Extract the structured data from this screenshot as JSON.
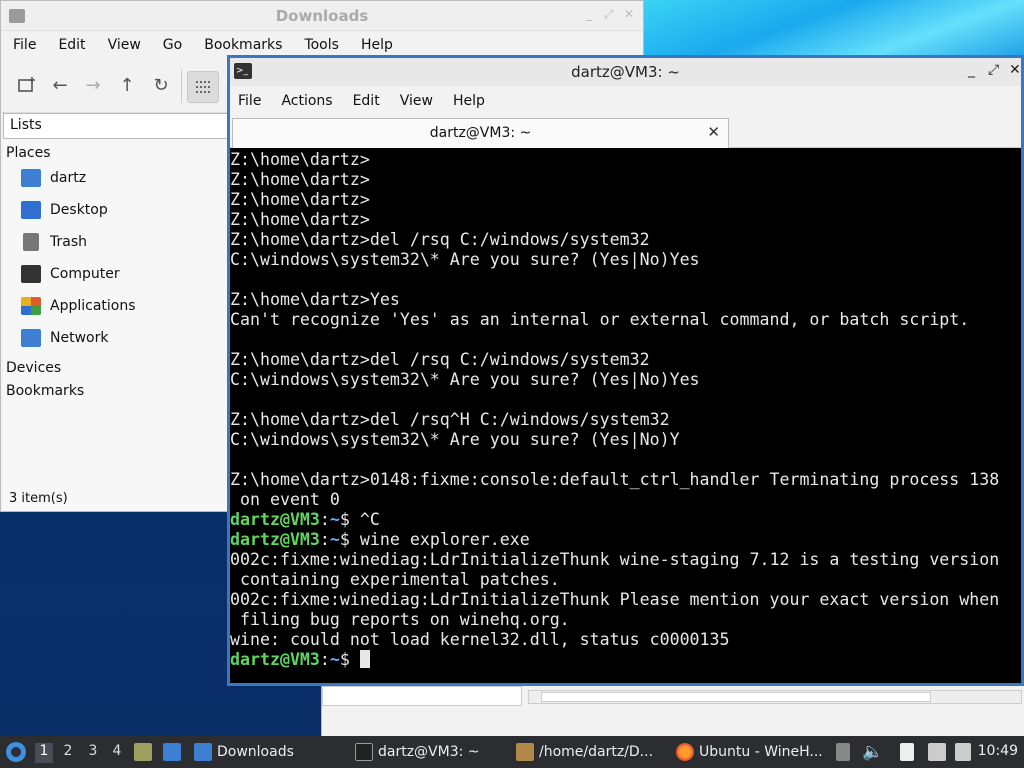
{
  "file_manager": {
    "title": "Downloads",
    "menu": [
      "File",
      "Edit",
      "View",
      "Go",
      "Bookmarks",
      "Tools",
      "Help"
    ],
    "side_pane_mode": "Lists",
    "sections": {
      "places": "Places",
      "devices": "Devices",
      "bookmarks": "Bookmarks"
    },
    "places": [
      {
        "label": "dartz",
        "icon": "home-folder-icon",
        "color": "#3d7fd0"
      },
      {
        "label": "Desktop",
        "icon": "desktop-icon",
        "color": "#2f6fd0"
      },
      {
        "label": "Trash",
        "icon": "trash-icon",
        "color": "#777777"
      },
      {
        "label": "Computer",
        "icon": "computer-icon",
        "color": "#333333"
      },
      {
        "label": "Applications",
        "icon": "applications-icon",
        "color": "#e05a2a"
      },
      {
        "label": "Network",
        "icon": "network-icon",
        "color": "#3d7fd0"
      }
    ],
    "status": "3 item(s)"
  },
  "terminal": {
    "window_title": "dartz@VM3: ~",
    "menu": [
      "File",
      "Actions",
      "Edit",
      "View",
      "Help"
    ],
    "tab_label": "dartz@VM3: ~",
    "lines": [
      {
        "text": "Z:\\home\\dartz>"
      },
      {
        "text": "Z:\\home\\dartz>"
      },
      {
        "text": "Z:\\home\\dartz>"
      },
      {
        "text": "Z:\\home\\dartz>"
      },
      {
        "text": "Z:\\home\\dartz>del /rsq C:/windows/system32"
      },
      {
        "text": "C:\\windows\\system32\\* Are you sure? (Yes|No)Yes"
      },
      {
        "text": ""
      },
      {
        "text": "Z:\\home\\dartz>Yes"
      },
      {
        "text": "Can't recognize 'Yes' as an internal or external command, or batch script."
      },
      {
        "text": ""
      },
      {
        "text": "Z:\\home\\dartz>del /rsq C:/windows/system32"
      },
      {
        "text": "C:\\windows\\system32\\* Are you sure? (Yes|No)Yes"
      },
      {
        "text": ""
      },
      {
        "text": "Z:\\home\\dartz>del /rsq^H C:/windows/system32"
      },
      {
        "text": "C:\\windows\\system32\\* Are you sure? (Yes|No)Y"
      },
      {
        "text": ""
      },
      {
        "text": "Z:\\home\\dartz>0148:fixme:console:default_ctrl_handler Terminating process 138"
      },
      {
        "text": " on event 0"
      },
      {
        "prompt_user": "dartz@VM3",
        "prompt_sep": ":",
        "prompt_path": "~",
        "text": "$ ^C"
      },
      {
        "prompt_user": "dartz@VM3",
        "prompt_sep": ":",
        "prompt_path": "~",
        "text": "$ wine explorer.exe"
      },
      {
        "text": "002c:fixme:winediag:LdrInitializeThunk wine-staging 7.12 is a testing version"
      },
      {
        "text": " containing experimental patches."
      },
      {
        "text": "002c:fixme:winediag:LdrInitializeThunk Please mention your exact version when"
      },
      {
        "text": " filing bug reports on winehq.org."
      },
      {
        "text": "wine: could not load kernel32.dll, status c0000135"
      },
      {
        "prompt_user": "dartz@VM3",
        "prompt_sep": ":",
        "prompt_path": "~",
        "text": "$ ",
        "cursor": true
      }
    ],
    "colors": {
      "prompt_user": "#5fd75f",
      "prompt_path": "#5fafff",
      "border": "#3a78c2"
    }
  },
  "taskbar": {
    "workspaces": [
      "1",
      "2",
      "3",
      "4"
    ],
    "active_workspace": "1",
    "tasks": [
      {
        "label": "Downloads",
        "icon": "folder-icon"
      },
      {
        "label": "dartz@VM3: ~",
        "icon": "terminal-icon"
      },
      {
        "label": "/home/dartz/D...",
        "icon": "archive-icon"
      },
      {
        "label": "Ubuntu - WineH...",
        "icon": "firefox-icon"
      }
    ],
    "clock": "10:49"
  }
}
